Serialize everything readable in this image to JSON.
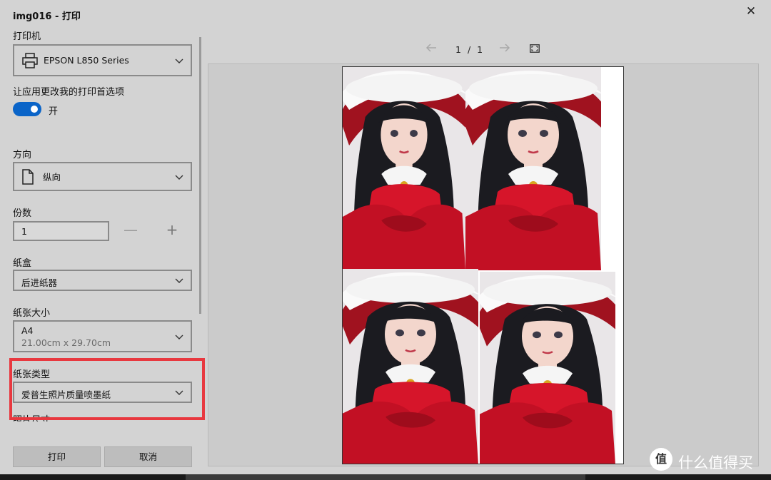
{
  "window": {
    "title": "img016 - 打印"
  },
  "left": {
    "printer": {
      "label": "打印机",
      "value": "EPSON L850 Series"
    },
    "allow_app": {
      "label": "让应用更改我的打印首选项",
      "toggle_state": "开",
      "on": true
    },
    "orientation": {
      "label": "方向",
      "value": "纵向"
    },
    "copies": {
      "label": "份数",
      "value": "1",
      "minus": "—",
      "plus": "+"
    },
    "tray": {
      "label": "纸盒",
      "value": "后进纸器"
    },
    "paper_size": {
      "label": "纸张大小",
      "value": "A4",
      "sub": "21.00cm x 29.70cm"
    },
    "paper_type": {
      "label": "纸张类型",
      "value": "爱普生照片质量喷墨纸"
    },
    "photo_size": {
      "label": "照片尺寸"
    },
    "buttons": {
      "print": "打印",
      "cancel": "取消"
    }
  },
  "preview": {
    "page_current": "1",
    "separator": "/",
    "page_total": "1"
  },
  "watermark": {
    "icon": "值",
    "text": "什么值得买"
  },
  "colors": {
    "accent": "#0a64c8",
    "highlight": "#e8383f",
    "costume_red": "#d6152a"
  }
}
